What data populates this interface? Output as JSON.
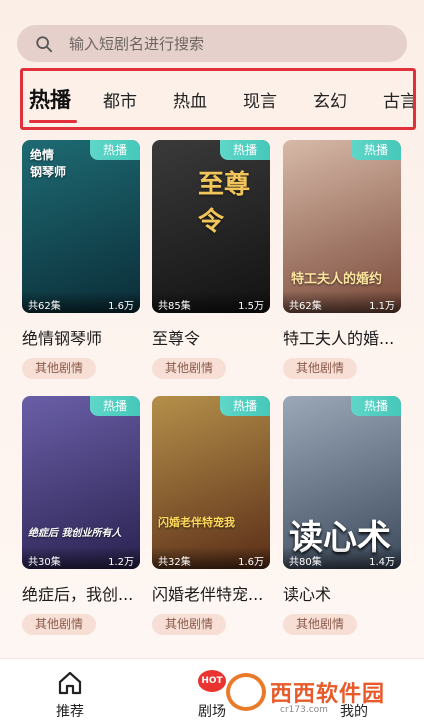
{
  "search": {
    "placeholder": "输入短剧名进行搜索"
  },
  "tabs": [
    "热播",
    "都市",
    "热血",
    "现言",
    "玄幻",
    "古言"
  ],
  "cards": [
    {
      "name": "绝情钢琴师",
      "cover_title": "绝情\n钢琴师",
      "badge": "热播",
      "episodes": "共62集",
      "views": "1.6万",
      "tag": "其他剧情",
      "bg": [
        "#1e6b73",
        "#0b2d38"
      ]
    },
    {
      "name": "至尊令",
      "cover_title": "至尊令",
      "badge": "热播",
      "episodes": "共85集",
      "views": "1.5万",
      "tag": "其他剧情",
      "bg": [
        "#3a3a3a",
        "#121212"
      ]
    },
    {
      "name": "特工夫人的婚...",
      "cover_title": "特工夫人的婚约",
      "badge": "热播",
      "episodes": "共62集",
      "views": "1.1万",
      "tag": "其他剧情",
      "bg": [
        "#d7b9a8",
        "#7a4a3a"
      ]
    },
    {
      "name": "绝症后，我创...",
      "cover_title": "绝症后  我创业所有人",
      "badge": "热播",
      "episodes": "共30集",
      "views": "1.2万",
      "tag": "其他剧情",
      "bg": [
        "#6a5fa8",
        "#2a2250"
      ]
    },
    {
      "name": "闪婚老伴特宠...",
      "cover_title": "闪婚老伴特宠我",
      "badge": "热播",
      "episodes": "共32集",
      "views": "1.6万",
      "tag": "其他剧情",
      "bg": [
        "#b4904a",
        "#5a2e18"
      ]
    },
    {
      "name": "读心术",
      "cover_title": "读心术",
      "badge": "热播",
      "episodes": "共80集",
      "views": "1.4万",
      "tag": "其他剧情",
      "bg": [
        "#9aa8b8",
        "#3d4a5c"
      ]
    }
  ],
  "bottom_nav": {
    "home": "推荐",
    "theater": "剧场",
    "mine": "我的",
    "hot": "HOT"
  },
  "watermark": {
    "text": "西西软件园",
    "sub": "cr173.com"
  }
}
